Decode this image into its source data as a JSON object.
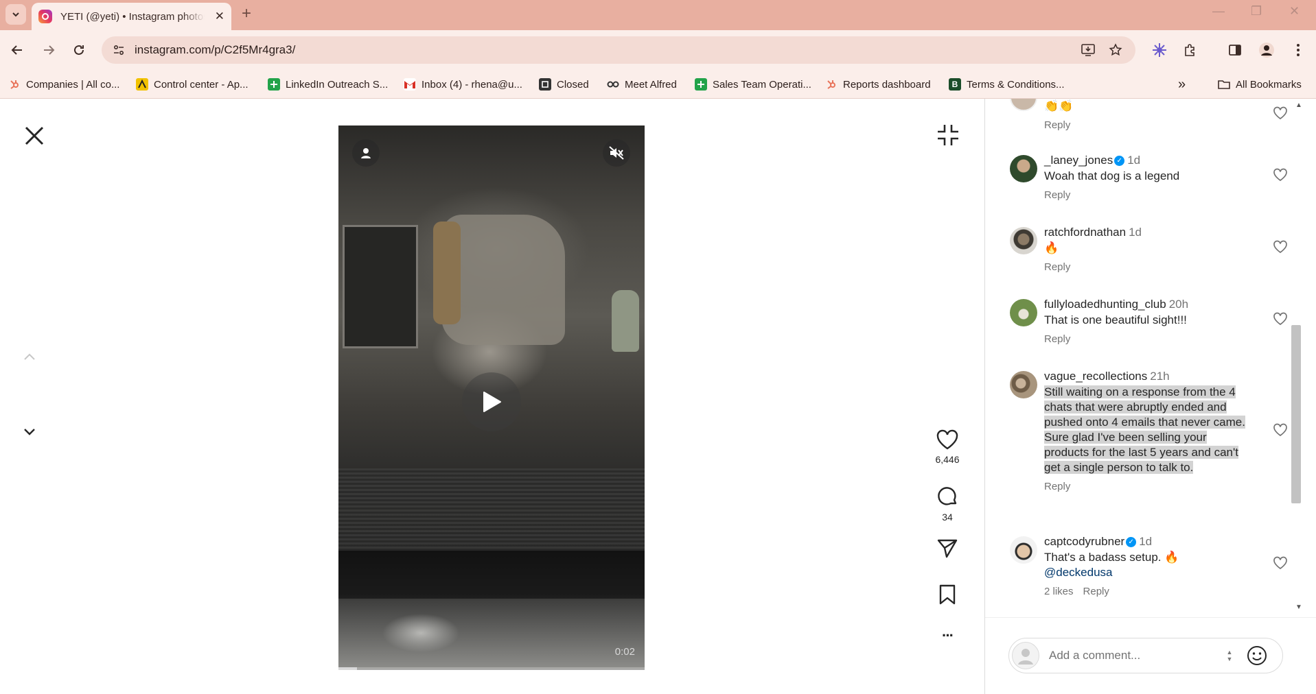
{
  "browser": {
    "tab_title": "YETI (@yeti) • Instagram photos and videos",
    "tab_close": "✕",
    "new_tab": "+",
    "url": "instagram.com/p/C2f5Mr4gra3/",
    "window_controls": {
      "minimize": "—",
      "maximize": "❐",
      "close": "✕"
    }
  },
  "bookmarks": {
    "items": [
      {
        "label": "Companies | All co...",
        "color": "#e8735a"
      },
      {
        "label": "Control center - Ap...",
        "color": "#f2c200"
      },
      {
        "label": "LinkedIn Outreach S...",
        "color": "#22a34a"
      },
      {
        "label": "Inbox (4) - rhena@u...",
        "color": "#d93025"
      },
      {
        "label": "Closed",
        "color": "#333333"
      },
      {
        "label": "Meet Alfred",
        "color": "#444444"
      },
      {
        "label": "Sales Team Operati...",
        "color": "#22a34a"
      },
      {
        "label": "Reports dashboard",
        "color": "#e8735a"
      },
      {
        "label": "Terms & Conditions...",
        "color": "#1b4d2a"
      }
    ],
    "overflow": "»",
    "all_bookmarks": "All Bookmarks"
  },
  "video": {
    "time": "0:02",
    "progress": 0.06
  },
  "actions": {
    "likes": "6,446",
    "comments": "34",
    "more": "···"
  },
  "comments": [
    {
      "username": "",
      "verified": false,
      "time": "",
      "text": "👏👏",
      "meta": [
        "Reply"
      ],
      "avatar_color": "#c9b8a8"
    },
    {
      "username": "_laney_jones",
      "verified": true,
      "time": "1d",
      "text": "Woah that dog is a legend",
      "meta": [
        "Reply"
      ],
      "avatar_color": "#3f5a3a"
    },
    {
      "username": "ratchfordnathan",
      "verified": false,
      "time": "1d",
      "text": "🔥",
      "meta": [
        "Reply"
      ],
      "avatar_color": "#5b5448"
    },
    {
      "username": "fullyloadedhunting_club",
      "verified": false,
      "time": "20h",
      "text": "That is one beautiful sight!!!",
      "meta": [
        "Reply"
      ],
      "avatar_color": "#6f8f4a"
    },
    {
      "username": "vague_recollections",
      "verified": false,
      "time": "21h",
      "text": "Still waiting on a response from the 4 chats that were abruptly ended and pushed onto 4 emails that never came. Sure glad I've been selling your products for the last 5 years and can't get a single person to talk to.",
      "meta": [
        "Reply"
      ],
      "avatar_color": "#7a6850"
    },
    {
      "username": "captcodyrubner",
      "verified": true,
      "time": "1d",
      "text": "That's a badass setup. 🔥",
      "mention": "@deckedusa",
      "meta": [
        "2 likes",
        "Reply"
      ],
      "avatar_color": "#b89c84"
    }
  ],
  "comment_input": {
    "placeholder": "Add a comment..."
  },
  "colors": {
    "accent": "#0095f6",
    "tabbar": "#e8afa0",
    "toolbar": "#fbeeea"
  }
}
